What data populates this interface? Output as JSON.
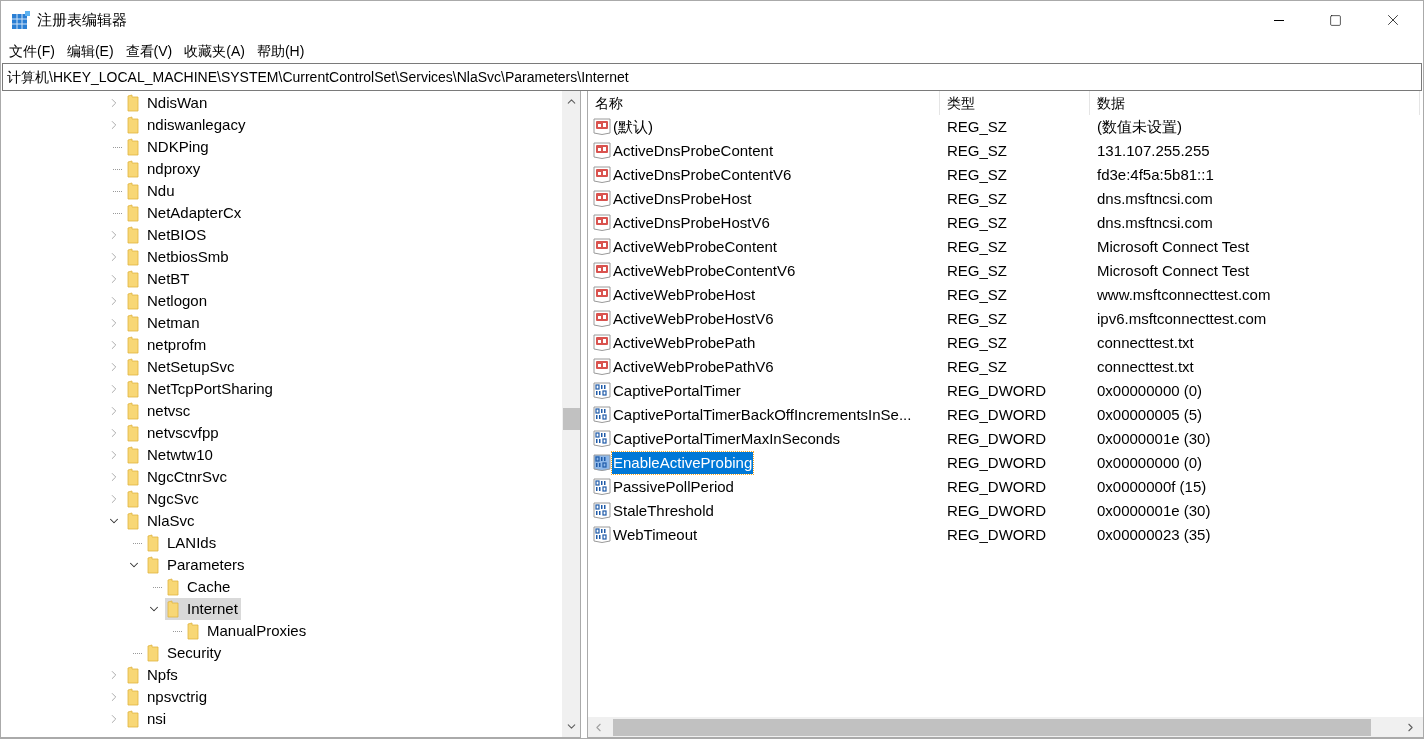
{
  "window": {
    "title": "注册表编辑器"
  },
  "menu": [
    "文件(F)",
    "编辑(E)",
    "查看(V)",
    "收藏夹(A)",
    "帮助(H)"
  ],
  "address": "计算机\\HKEY_LOCAL_MACHINE\\SYSTEM\\CurrentControlSet\\Services\\NlaSvc\\Parameters\\Internet",
  "tree": [
    {
      "name": "NdisWan",
      "kind": "collapsed",
      "selected": false
    },
    {
      "name": "ndiswanlegacy",
      "kind": "collapsed",
      "selected": false
    },
    {
      "name": "NDKPing",
      "kind": "leaf",
      "selected": false
    },
    {
      "name": "ndproxy",
      "kind": "leaf",
      "selected": false
    },
    {
      "name": "Ndu",
      "kind": "leaf",
      "selected": false
    },
    {
      "name": "NetAdapterCx",
      "kind": "leaf",
      "selected": false
    },
    {
      "name": "NetBIOS",
      "kind": "collapsed",
      "selected": false
    },
    {
      "name": "NetbiosSmb",
      "kind": "collapsed",
      "selected": false
    },
    {
      "name": "NetBT",
      "kind": "collapsed",
      "selected": false
    },
    {
      "name": "Netlogon",
      "kind": "collapsed",
      "selected": false
    },
    {
      "name": "Netman",
      "kind": "collapsed",
      "selected": false
    },
    {
      "name": "netprofm",
      "kind": "collapsed",
      "selected": false
    },
    {
      "name": "NetSetupSvc",
      "kind": "collapsed",
      "selected": false
    },
    {
      "name": "NetTcpPortSharing",
      "kind": "collapsed",
      "selected": false
    },
    {
      "name": "netvsc",
      "kind": "collapsed",
      "selected": false
    },
    {
      "name": "netvscvfpp",
      "kind": "collapsed",
      "selected": false
    },
    {
      "name": "Netwtw10",
      "kind": "collapsed",
      "selected": false
    },
    {
      "name": "NgcCtnrSvc",
      "kind": "collapsed",
      "selected": false
    },
    {
      "name": "NgcSvc",
      "kind": "collapsed",
      "selected": false
    },
    {
      "name": "NlaSvc",
      "kind": "expanded",
      "selected": false,
      "children": [
        {
          "name": "LANIds",
          "kind": "leaf",
          "selected": false
        },
        {
          "name": "Parameters",
          "kind": "expanded",
          "selected": false,
          "children": [
            {
              "name": "Cache",
              "kind": "leaf",
              "selected": false
            },
            {
              "name": "Internet",
              "kind": "expanded",
              "selected": true,
              "children": [
                {
                  "name": "ManualProxies",
                  "kind": "leaf",
                  "selected": false
                }
              ]
            }
          ]
        },
        {
          "name": "Security",
          "kind": "leaf",
          "selected": false
        }
      ]
    },
    {
      "name": "Npfs",
      "kind": "collapsed",
      "selected": false
    },
    {
      "name": "npsvctrig",
      "kind": "collapsed",
      "selected": false
    },
    {
      "name": "nsi",
      "kind": "collapsed",
      "selected": false
    }
  ],
  "table": {
    "columns": [
      "名称",
      "类型",
      "数据"
    ],
    "rows": [
      {
        "kind": "string",
        "name": "(默认)",
        "type": "REG_SZ",
        "data": "(数值未设置)",
        "selected": false
      },
      {
        "kind": "string",
        "name": "ActiveDnsProbeContent",
        "type": "REG_SZ",
        "data": "131.107.255.255",
        "selected": false
      },
      {
        "kind": "string",
        "name": "ActiveDnsProbeContentV6",
        "type": "REG_SZ",
        "data": "fd3e:4f5a:5b81::1",
        "selected": false
      },
      {
        "kind": "string",
        "name": "ActiveDnsProbeHost",
        "type": "REG_SZ",
        "data": "dns.msftncsi.com",
        "selected": false
      },
      {
        "kind": "string",
        "name": "ActiveDnsProbeHostV6",
        "type": "REG_SZ",
        "data": "dns.msftncsi.com",
        "selected": false
      },
      {
        "kind": "string",
        "name": "ActiveWebProbeContent",
        "type": "REG_SZ",
        "data": "Microsoft Connect Test",
        "selected": false
      },
      {
        "kind": "string",
        "name": "ActiveWebProbeContentV6",
        "type": "REG_SZ",
        "data": "Microsoft Connect Test",
        "selected": false
      },
      {
        "kind": "string",
        "name": "ActiveWebProbeHost",
        "type": "REG_SZ",
        "data": "www.msftconnecttest.com",
        "selected": false
      },
      {
        "kind": "string",
        "name": "ActiveWebProbeHostV6",
        "type": "REG_SZ",
        "data": "ipv6.msftconnecttest.com",
        "selected": false
      },
      {
        "kind": "string",
        "name": "ActiveWebProbePath",
        "type": "REG_SZ",
        "data": "connecttest.txt",
        "selected": false
      },
      {
        "kind": "string",
        "name": "ActiveWebProbePathV6",
        "type": "REG_SZ",
        "data": "connecttest.txt",
        "selected": false
      },
      {
        "kind": "binary",
        "name": "CaptivePortalTimer",
        "type": "REG_DWORD",
        "data": "0x00000000 (0)",
        "selected": false
      },
      {
        "kind": "binary",
        "name": "CaptivePortalTimerBackOffIncrementsInSe...",
        "type": "REG_DWORD",
        "data": "0x00000005 (5)",
        "selected": false
      },
      {
        "kind": "binary",
        "name": "CaptivePortalTimerMaxInSeconds",
        "type": "REG_DWORD",
        "data": "0x0000001e (30)",
        "selected": false
      },
      {
        "kind": "binary",
        "name": "EnableActiveProbing",
        "type": "REG_DWORD",
        "data": "0x00000000 (0)",
        "selected": true
      },
      {
        "kind": "binary",
        "name": "PassivePollPeriod",
        "type": "REG_DWORD",
        "data": "0x0000000f (15)",
        "selected": false
      },
      {
        "kind": "binary",
        "name": "StaleThreshold",
        "type": "REG_DWORD",
        "data": "0x0000001e (30)",
        "selected": false
      },
      {
        "kind": "binary",
        "name": "WebTimeout",
        "type": "REG_DWORD",
        "data": "0x00000023 (35)",
        "selected": false
      }
    ]
  }
}
